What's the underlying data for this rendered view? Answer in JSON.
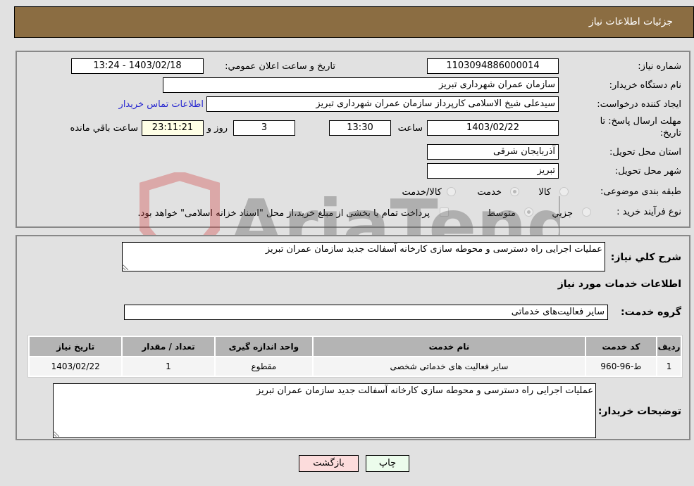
{
  "header": {
    "title": "جزئیات اطلاعات نیاز"
  },
  "details": {
    "need_number_label": "شماره نیاز:",
    "need_number": "1103094886000014",
    "announce_label": "تاریخ و ساعت اعلان عمومي:",
    "announce_value": "1403/02/18 - 13:24",
    "buyer_org_label": "نام دستگاه خریدار:",
    "buyer_org": "سازمان عمران شهرداری تبریز",
    "creator_label": "ایجاد کننده درخواست:",
    "creator": "سیدعلی شیخ الاسلامی کارپرداز سازمان عمران شهرداری تبریز",
    "contact_link": "اطلاعات تماس خریدار",
    "deadline_label_line1": "مهلت ارسال پاسخ: تا",
    "deadline_label_line2": "تاریخ:",
    "deadline_date": "1403/02/22",
    "time_label": "ساعت",
    "deadline_time": "13:30",
    "days_value": "3",
    "days_label": "روز و",
    "remaining_time": "23:11:21",
    "remaining_label": "ساعت باقي مانده",
    "province_label": "استان محل تحویل:",
    "province": "آذربایجان شرقی",
    "city_label": "شهر محل تحویل:",
    "city": "تبریز",
    "category_label": "طبقه بندی موضوعی:",
    "category_options": [
      {
        "label": "کالا",
        "checked": false
      },
      {
        "label": "خدمت",
        "checked": true
      },
      {
        "label": "کالا/خدمت",
        "checked": false
      }
    ],
    "process_label": "نوع فرآیند خرید :",
    "process_options": [
      {
        "label": "جزیي",
        "checked": false
      },
      {
        "label": "متوسط",
        "checked": true
      }
    ],
    "treasury_checkbox_label": "پرداخت تمام یا بخشی از مبلغ خرید،از محل \"اسناد خزانه اسلامی\" خواهد بود.",
    "treasury_checked": false
  },
  "services": {
    "summary_label": "شرح کلي نیاز:",
    "summary": "عملیات اجرایی راه دسترسی و محوطه سازی کارخانه آسفالت جدید سازمان عمران تبریز",
    "section_title": "اطلاعات خدمات مورد نیاز",
    "group_label": "گروه خدمت:",
    "group_value": "سایر فعالیت‌های خدماتی",
    "table": {
      "headers": [
        "ردیف",
        "کد خدمت",
        "نام خدمت",
        "واحد اندازه گیری",
        "تعداد / مقدار",
        "تاریخ نیاز"
      ],
      "rows": [
        [
          "1",
          "ط-96-960",
          "سایر فعالیت های خدماتی شخصی",
          "مقطوع",
          "1",
          "1403/02/22"
        ]
      ]
    },
    "buyer_notes_label": "توضیحات خریدار:",
    "buyer_notes": "عملیات اجرایی راه دسترسی و محوطه سازی کارخانه آسفالت جدید سازمان عمران تبریز"
  },
  "buttons": {
    "print": "چاپ",
    "back": "بازگشت"
  },
  "colors": {
    "header_bg": "#8b6d42",
    "back_button_bg": "#fcdcdc",
    "print_button_bg": "#ecfcec",
    "link": "#2a2ad0"
  }
}
